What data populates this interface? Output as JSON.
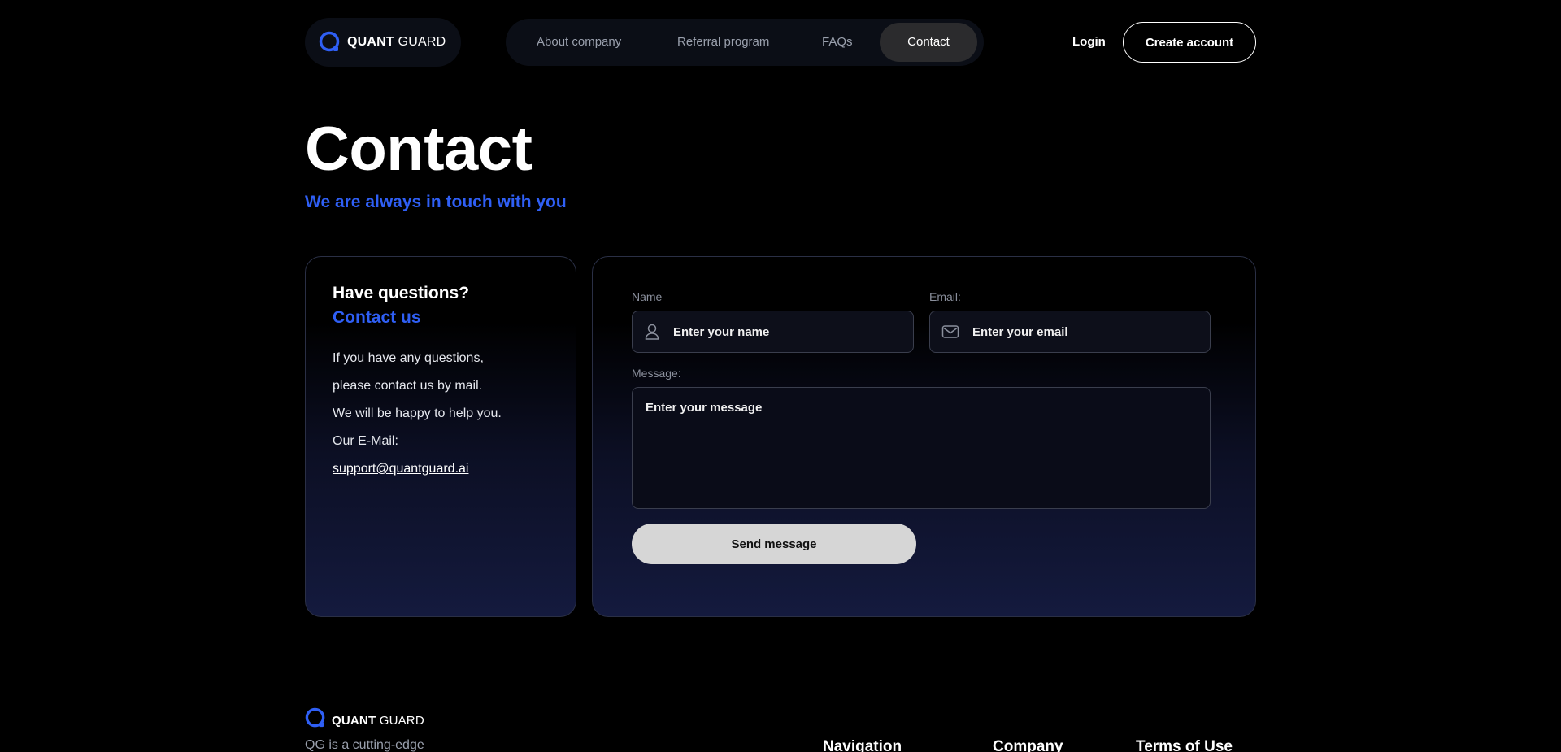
{
  "header": {
    "logo_bold": "QUANT",
    "logo_light": "GUARD",
    "nav": [
      "About company",
      "Referral program",
      "FAQs",
      "Contact"
    ],
    "login_label": "Login",
    "create_account_label": "Create account"
  },
  "page": {
    "title": "Contact",
    "subtitle": "We are always in touch with you"
  },
  "info_card": {
    "title": "Have questions?",
    "subtitle": "Contact us",
    "lines": [
      "If you have any questions,",
      "please contact us by mail.",
      "We will be happy to help you.",
      "Our E-Mail:"
    ],
    "email": "support@quantguard.ai"
  },
  "form": {
    "name_label": "Name",
    "name_placeholder": "Enter your name",
    "email_label": "Email:",
    "email_placeholder": "Enter your email",
    "message_label": "Message:",
    "message_placeholder": "Enter your message",
    "send_label": "Send message"
  },
  "footer": {
    "logo_bold": "QUANT",
    "logo_light": "GUARD",
    "description": "QG is a cutting-edge",
    "headings": [
      "Navigation",
      "Company",
      "Terms of Use"
    ]
  },
  "colors": {
    "accent": "#2f5ff5",
    "background": "#000000",
    "send_button": "#d6d6d6"
  },
  "icons": {
    "logo": "quantguard-q-logo",
    "name_field": "user-icon",
    "email_field": "mail-icon"
  }
}
